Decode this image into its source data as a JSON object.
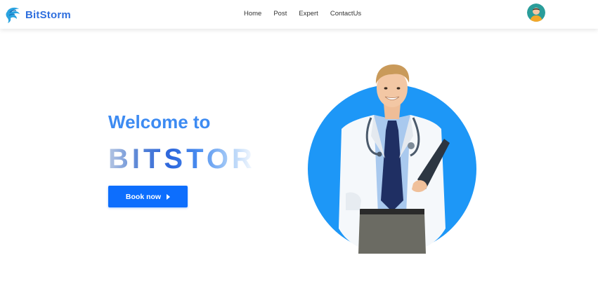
{
  "brand": {
    "name": "BitStorm",
    "color": "#2f6fde"
  },
  "nav": {
    "items": [
      {
        "label": "Home"
      },
      {
        "label": "Post"
      },
      {
        "label": "Expert"
      },
      {
        "label": "ContactUs"
      }
    ]
  },
  "user": {
    "avatar_icon": "user-avatar"
  },
  "hero": {
    "title": "Welcome to",
    "brand_text": "BITSTORM",
    "button_label": "Book now",
    "button_icon": "caret-right-icon",
    "image_icon": "doctor-illustration",
    "accent_color": "#0d6efd",
    "circle_color": "#1d97f7"
  }
}
